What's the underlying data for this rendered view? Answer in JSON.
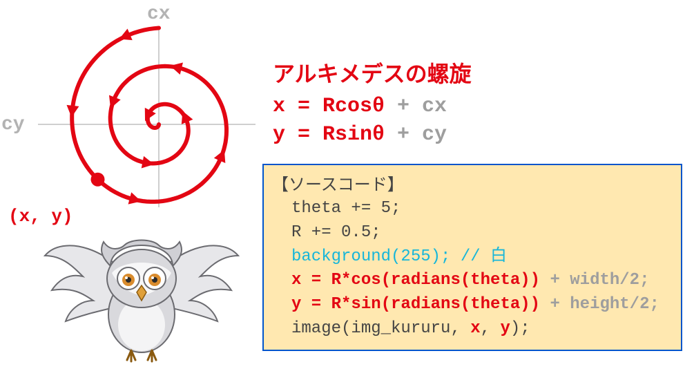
{
  "axis": {
    "cx": "cx",
    "cy": "cy"
  },
  "point_label": "(x, y)",
  "equation": {
    "title": "アルキメデスの螺旋",
    "line1_lhs": " x = Rcosθ",
    "line1_rhs": " + cx",
    "line2_lhs": " y = Rsinθ",
    "line2_rhs": " + cy"
  },
  "code": {
    "title": "【ソースコード】",
    "l1": "theta += 5;",
    "l2": "R += 0.5;",
    "l3a": "background(255); ",
    "l3b": "// 白",
    "l4a": "x = R*cos(radians(theta))",
    "l4b": " + width/2;",
    "l5a": "y = R*sin(radians(theta))",
    "l5b": " + height/2;",
    "l6a": "image(img_kururu, ",
    "l6b": "x",
    "l6c": ", ",
    "l6d": "y",
    "l6e": ");"
  }
}
